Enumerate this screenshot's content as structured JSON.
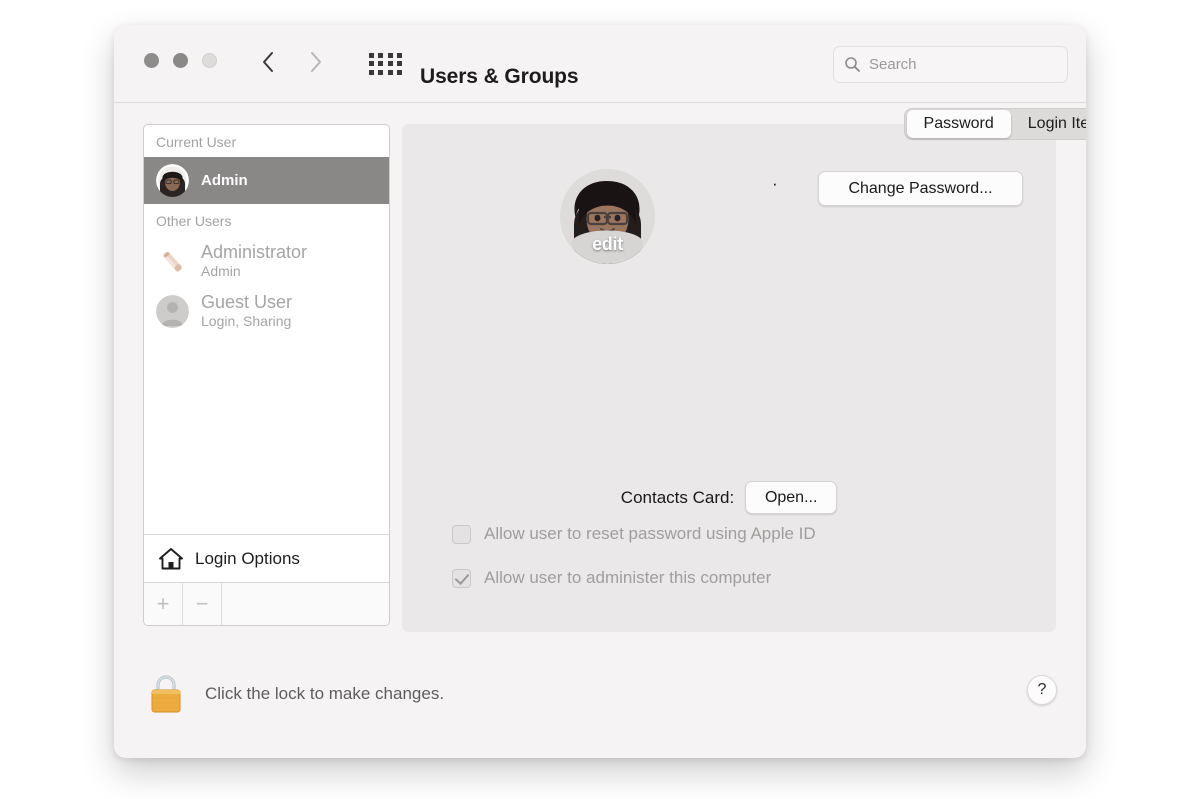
{
  "window": {
    "title": "Users & Groups",
    "traffic_lights": [
      "close",
      "minimize",
      "zoom"
    ],
    "nav": {
      "back": "back-chevron",
      "forward": "forward-chevron"
    },
    "grid_button": "show-all-grid-icon",
    "search": {
      "placeholder": "Search",
      "value": "",
      "icon": "search-icon"
    }
  },
  "sidebar": {
    "current_user_header": "Current User",
    "other_users_header": "Other Users",
    "current_user": {
      "name": "Admin",
      "avatar": "memoji-avatar",
      "selected": true
    },
    "other_users": [
      {
        "name": "Administrator",
        "role": "Admin",
        "avatar": "custom-avatar"
      },
      {
        "name": "Guest User",
        "role": "Login, Sharing",
        "avatar": "person-silhouette-avatar"
      }
    ],
    "login_options": {
      "label": "Login Options",
      "icon": "home-icon"
    },
    "add_button": "+",
    "remove_button": "−"
  },
  "tabs": [
    {
      "label": "Password",
      "active": true
    },
    {
      "label": "Login Items",
      "active": false
    }
  ],
  "account": {
    "avatar_edit_label": "edit",
    "full_name": "·",
    "change_password_label": "Change Password...",
    "contacts_card_label": "Contacts Card:",
    "contacts_open_label": "Open...",
    "checkboxes": [
      {
        "label": "Allow user to reset password using Apple ID",
        "checked": false,
        "enabled": false
      },
      {
        "label": "Allow user to administer this computer",
        "checked": true,
        "enabled": false
      }
    ]
  },
  "footer": {
    "lock_icon": "padlock-closed-icon",
    "lock_text": "Click the lock to make changes.",
    "help_label": "?"
  },
  "colors": {
    "window_bg": "#f5f3f3",
    "panel_bg": "#eae8e8",
    "selection": "#8a8787",
    "lock_gold": "#eeab3e",
    "text_primary": "#1a1818",
    "text_muted": "#a7a4a4"
  }
}
